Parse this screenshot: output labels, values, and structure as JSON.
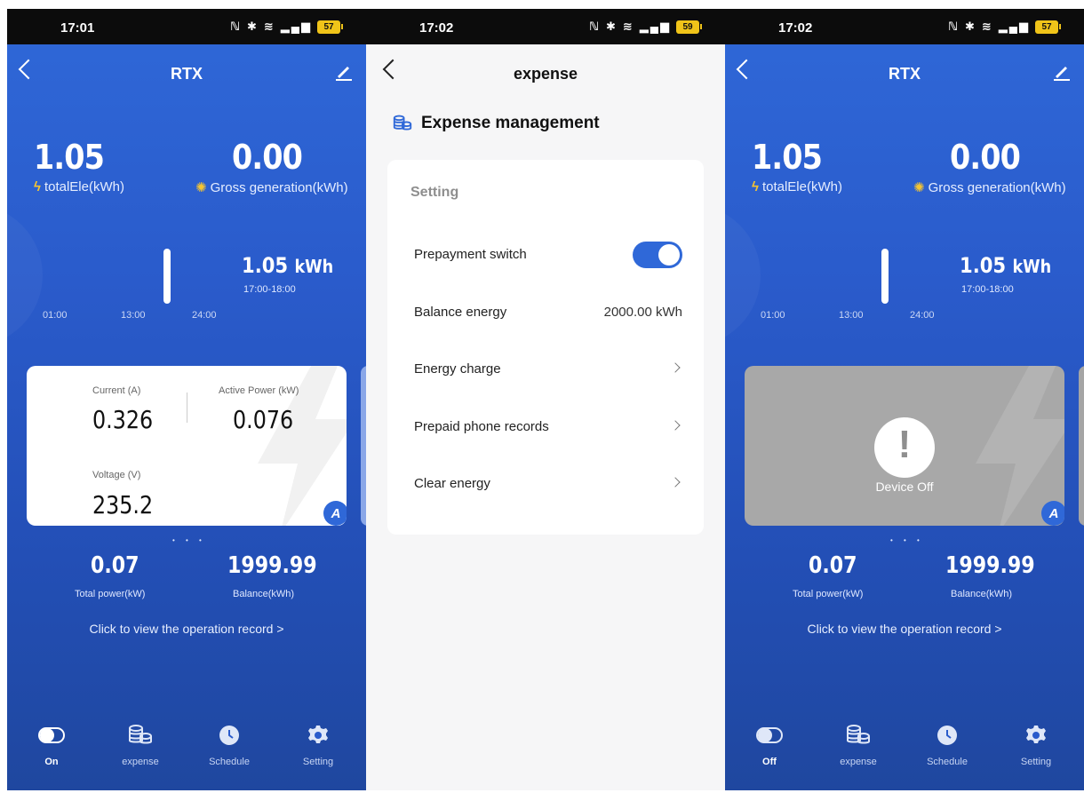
{
  "phone1": {
    "status": {
      "time": "17:01",
      "battery": "57"
    },
    "title": "RTX",
    "total_ele": {
      "value": "1.05",
      "label": "totalEle(kWh)"
    },
    "gross_gen": {
      "value": "0.00",
      "label": "Gross generation(kWh)"
    },
    "bar_reading": {
      "value": "1.05",
      "unit": "kWh",
      "range": "17:00-18:00"
    },
    "axis": [
      "01:00",
      "13:00",
      "24:00"
    ],
    "card": {
      "current_label": "Current (A)",
      "current_value": "0.326",
      "power_label": "Active Power (kW)",
      "power_value": "0.076",
      "voltage_label": "Voltage (V)",
      "voltage_value": "235.2",
      "badge": "A"
    },
    "dots": "• • •",
    "total_power": {
      "value": "0.07",
      "label": "Total power(kW)"
    },
    "balance": {
      "value": "1999.99",
      "label": "Balance(kWh)"
    },
    "operation_record": "Click to view the operation record >",
    "tabs": [
      "On",
      "expense",
      "Schedule",
      "Setting"
    ]
  },
  "phone2": {
    "status": {
      "time": "17:02",
      "battery": "59"
    },
    "title": "expense",
    "section_title": "Expense management",
    "setting_label": "Setting",
    "rows": {
      "prepayment": "Prepayment switch",
      "balance_label": "Balance energy",
      "balance_value": "2000.00 kWh",
      "charge": "Energy charge",
      "records": "Prepaid phone records",
      "clear": "Clear energy"
    },
    "prepayment_on": true
  },
  "phone3": {
    "status": {
      "time": "17:02",
      "battery": "57"
    },
    "title": "RTX",
    "total_ele": {
      "value": "1.05",
      "label": "totalEle(kWh)"
    },
    "gross_gen": {
      "value": "0.00",
      "label": "Gross generation(kWh)"
    },
    "bar_reading": {
      "value": "1.05",
      "unit": "kWh",
      "range": "17:00-18:00"
    },
    "axis": [
      "01:00",
      "13:00",
      "24:00"
    ],
    "device_off": "Device Off",
    "badge": "A",
    "dots": "• • •",
    "total_power": {
      "value": "0.07",
      "label": "Total power(kW)"
    },
    "balance": {
      "value": "1999.99",
      "label": "Balance(kWh)"
    },
    "operation_record": "Click to view the operation record >",
    "tabs": [
      "Off",
      "expense",
      "Schedule",
      "Setting"
    ]
  },
  "colors": {
    "primary": "#2f68d8",
    "bolt": "#f6c531",
    "device_off_bg": "#a8a8a8"
  }
}
